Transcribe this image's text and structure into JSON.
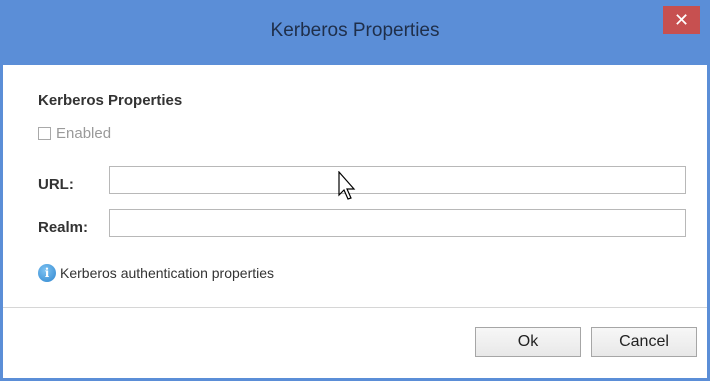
{
  "dialog": {
    "title": "Kerberos Properties",
    "close_glyph": "✕"
  },
  "form": {
    "section_title": "Kerberos Properties",
    "enabled_label": "Enabled",
    "enabled_checked": false,
    "url_label": "URL:",
    "url_value": "",
    "realm_label": "Realm:",
    "realm_value": "",
    "info_text": "Kerberos authentication properties"
  },
  "buttons": {
    "ok_label": "Ok",
    "cancel_label": "Cancel"
  },
  "colors": {
    "titlebar": "#5b8ed7",
    "close_button": "#c75050",
    "info_icon": "#2f86cf"
  }
}
